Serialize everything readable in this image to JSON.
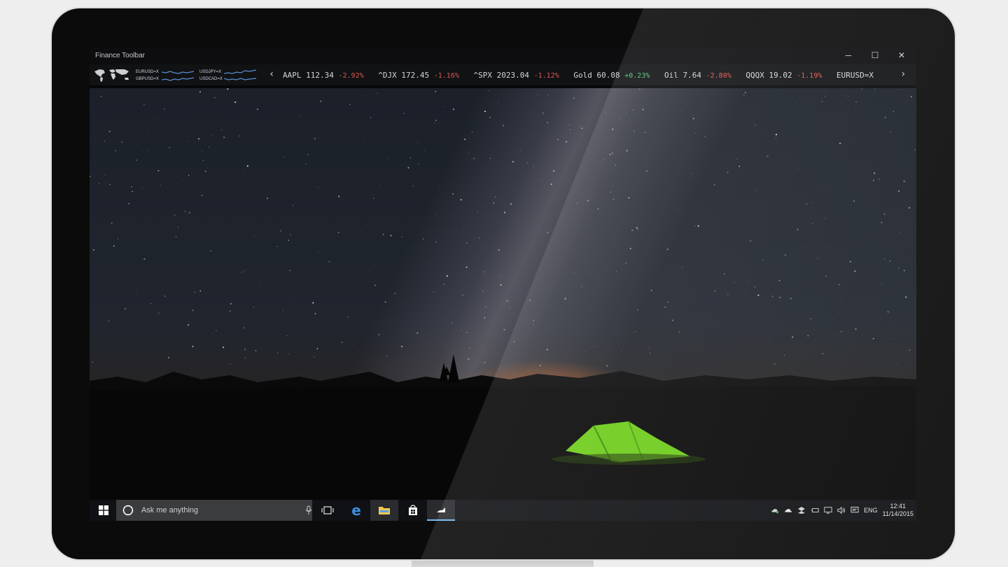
{
  "window": {
    "title": "Finance Toolbar",
    "minimize": "─",
    "maximize": "☐",
    "close": "✕"
  },
  "mini_charts": [
    {
      "label": "EURUSD=X"
    },
    {
      "label": "GBPUSD=X"
    },
    {
      "label": "USDJPY=X"
    },
    {
      "label": "USDCAD=X"
    }
  ],
  "ticker": {
    "prev": "‹",
    "next": "›",
    "quotes": [
      {
        "symbol": "AAPL",
        "price": "112.34",
        "change": "-2.92%",
        "direction": "down"
      },
      {
        "symbol": "^DJX",
        "price": "172.45",
        "change": "-1.16%",
        "direction": "down"
      },
      {
        "symbol": "^SPX",
        "price": "2023.04",
        "change": "-1.12%",
        "direction": "down"
      },
      {
        "symbol": "Gold",
        "price": "60.08",
        "change": "+0.23%",
        "direction": "up"
      },
      {
        "symbol": "Oil",
        "price": "7.64",
        "change": "-2.80%",
        "direction": "down"
      },
      {
        "symbol": "QQQX",
        "price": "19.02",
        "change": "-1.19%",
        "direction": "down"
      },
      {
        "symbol": "EURUSD=X",
        "price": "",
        "change": "",
        "direction": ""
      }
    ]
  },
  "taskbar": {
    "search_placeholder": "Ask me anything",
    "language": "ENG",
    "time": "12:41",
    "date": "11/14/2015"
  },
  "colors": {
    "negative": "#e0574f",
    "positive": "#55c27a",
    "accent": "#76b9ed",
    "tent": "#7fd61a"
  }
}
